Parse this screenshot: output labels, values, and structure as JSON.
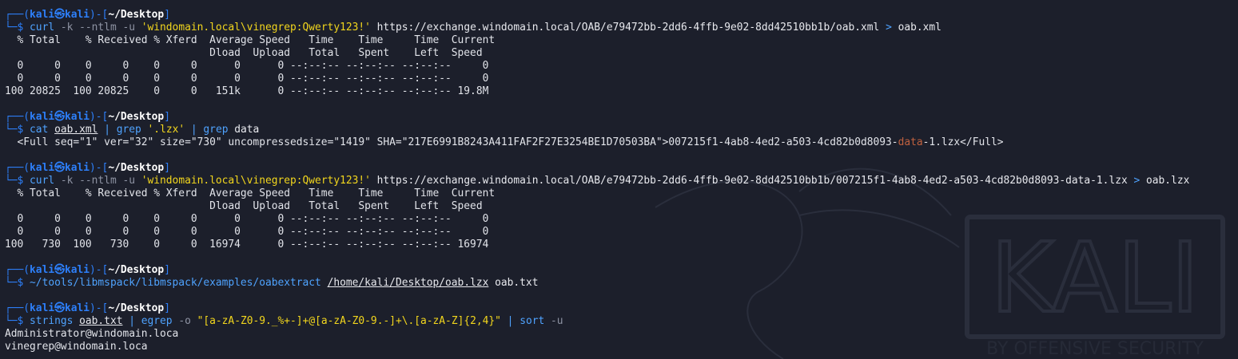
{
  "prompt": {
    "open": "┌──(",
    "user": "kali㉿kali",
    "mid": ")-[",
    "dir": "~/Desktop",
    "close": "]",
    "arrow": "└─$ "
  },
  "blocks": [
    {
      "cmd_parts": [
        "curl",
        " -k --ntlm -u ",
        "'windomain.local\\vinegrep:Qwerty123!'",
        " https://exchange.windomain.local/OAB/e79472bb-2dd6-4ffb-9e02-8dd42510bb1b/oab.xml ",
        ">",
        " oab.xml"
      ],
      "output": [
        "  % Total    % Received % Xferd  Average Speed   Time    Time     Time  Current",
        "                                 Dload  Upload   Total   Spent    Left  Speed",
        "  0     0    0     0    0     0      0      0 --:--:-- --:--:-- --:--:--     0",
        "  0     0    0     0    0     0      0      0 --:--:-- --:--:-- --:--:--     0",
        "100 20825  100 20825    0     0   151k      0 --:--:-- --:--:-- --:--:-- 19.8M"
      ]
    },
    {
      "cmd_parts": [
        "cat",
        " ",
        "oab.xml",
        " | ",
        "grep",
        " ",
        "'.lzx'",
        " | ",
        "grep",
        " data"
      ],
      "output_pre": "  <Full seq=\"1\" ver=\"32\" size=\"730\" uncompressedsize=\"1419\" SHA=\"217E6991B8243A411FAF2F27E3254BE1D70503BA\">007215f1-4ab8-4ed2-a503-4cd82b0d8093-",
      "output_hl": "data",
      "output_post": "-1.lzx</Full>"
    },
    {
      "cmd_parts": [
        "curl",
        " -k --ntlm -u ",
        "'windomain.local\\vinegrep:Qwerty123!'",
        " https://exchange.windomain.local/OAB/e79472bb-2dd6-4ffb-9e02-8dd42510bb1b/007215f1-4ab8-4ed2-a503-4cd82b0d8093-data-1.lzx ",
        ">",
        " oab.lzx"
      ],
      "output": [
        "  % Total    % Received % Xferd  Average Speed   Time    Time     Time  Current",
        "                                 Dload  Upload   Total   Spent    Left  Speed",
        "  0     0    0     0    0     0      0      0 --:--:-- --:--:-- --:--:--     0",
        "  0     0    0     0    0     0      0      0 --:--:-- --:--:-- --:--:--     0",
        "100   730  100   730    0     0  16974      0 --:--:-- --:--:-- --:--:-- 16974"
      ]
    },
    {
      "cmd_parts": [
        "~/tools/libmspack/libmspack/examples/oabextract",
        " ",
        "/home/kali/Desktop/oab.lzx",
        " oab.txt"
      ]
    },
    {
      "cmd_parts": [
        "strings",
        " ",
        "oab.txt",
        " | ",
        "egrep",
        " -o ",
        "\"[a-zA-Z0-9._%+-]+@[a-zA-Z0-9.-]+\\.[a-zA-Z]{2,4}\"",
        " | ",
        "sort",
        " -u"
      ],
      "output": [
        "Administrator@windomain.loca",
        "vinegrep@windomain.loca"
      ]
    }
  ],
  "watermark": {
    "text": "KALI",
    "tagline": "BY OFFENSIVE SECURITY"
  },
  "colors": {
    "background": "#1c1f2b",
    "prompt_blue": "#2d7ff9",
    "string_yellow": "#f2d61d",
    "grep_highlight": "#c0613f"
  }
}
